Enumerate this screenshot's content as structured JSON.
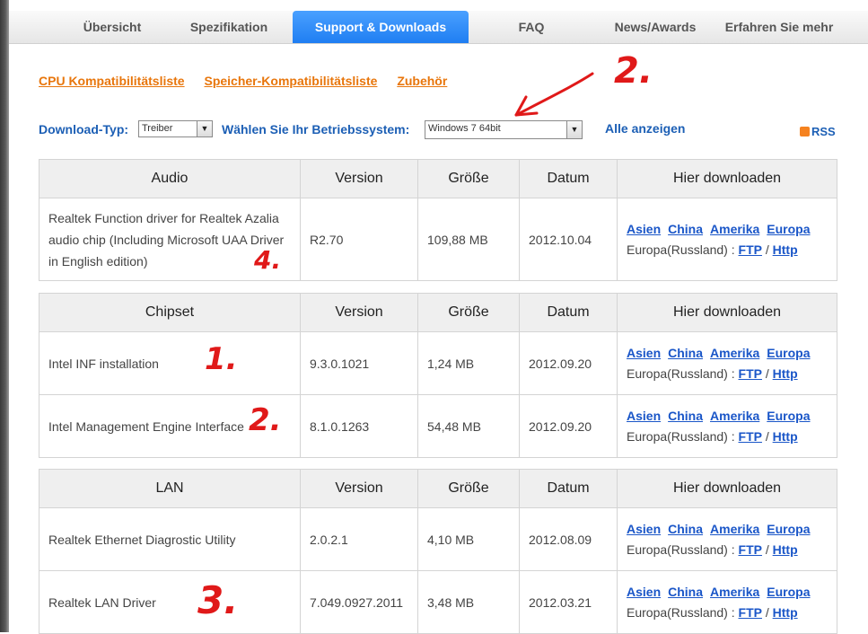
{
  "tabs": [
    "Übersicht",
    "Spezifikation",
    "Support & Downloads",
    "FAQ",
    "News/Awards",
    "Erfahren Sie mehr"
  ],
  "active_tab": "Support & Downloads",
  "sublinks": [
    "CPU Kompatibilitätsliste",
    "Speicher-Kompatibilitätsliste",
    "Zubehör"
  ],
  "filter": {
    "type_label": "Download-Typ:",
    "type_value": "Treiber",
    "os_label": "Wählen Sie Ihr Betriebssystem:",
    "os_value": "Windows 7 64bit",
    "show_all": "Alle anzeigen",
    "rss": "RSS"
  },
  "headers": {
    "version": "Version",
    "size": "Größe",
    "date": "Datum",
    "download": "Hier downloaden"
  },
  "download_links": {
    "asia": "Asien",
    "china": "China",
    "america": "Amerika",
    "europe": "Europa",
    "russia_label": "Europa(Russland) :",
    "ftp": "FTP",
    "slash": "/",
    "http": "Http"
  },
  "sections": [
    {
      "title": "Audio",
      "rows": [
        {
          "name": "Realtek Function driver for Realtek Azalia audio chip (Including Microsoft UAA Driver in English edition)",
          "version": "R2.70",
          "size": "109,88 MB",
          "date": "2012.10.04"
        }
      ]
    },
    {
      "title": "Chipset",
      "rows": [
        {
          "name": "Intel INF installation",
          "version": "9.3.0.1021",
          "size": "1,24 MB",
          "date": "2012.09.20"
        },
        {
          "name": "Intel Management Engine Interface",
          "version": "8.1.0.1263",
          "size": "54,48 MB",
          "date": "2012.09.20"
        }
      ]
    },
    {
      "title": "LAN",
      "rows": [
        {
          "name": "Realtek Ethernet Diagrostic Utility",
          "version": "2.0.2.1",
          "size": "4,10 MB",
          "date": "2012.08.09"
        },
        {
          "name": "Realtek LAN Driver",
          "version": "7.049.0927.2011",
          "size": "3,48 MB",
          "date": "2012.03.21"
        }
      ]
    }
  ],
  "annotations": {
    "a2_top": "2.",
    "a4": "4.",
    "a1": "1.",
    "a2": "2.",
    "a3": "3."
  },
  "colors": {
    "accent_orange": "#e8760c",
    "link_blue": "#1c5fb5",
    "annotation_red": "#e01919",
    "active_tab": "#1f7ef2"
  }
}
